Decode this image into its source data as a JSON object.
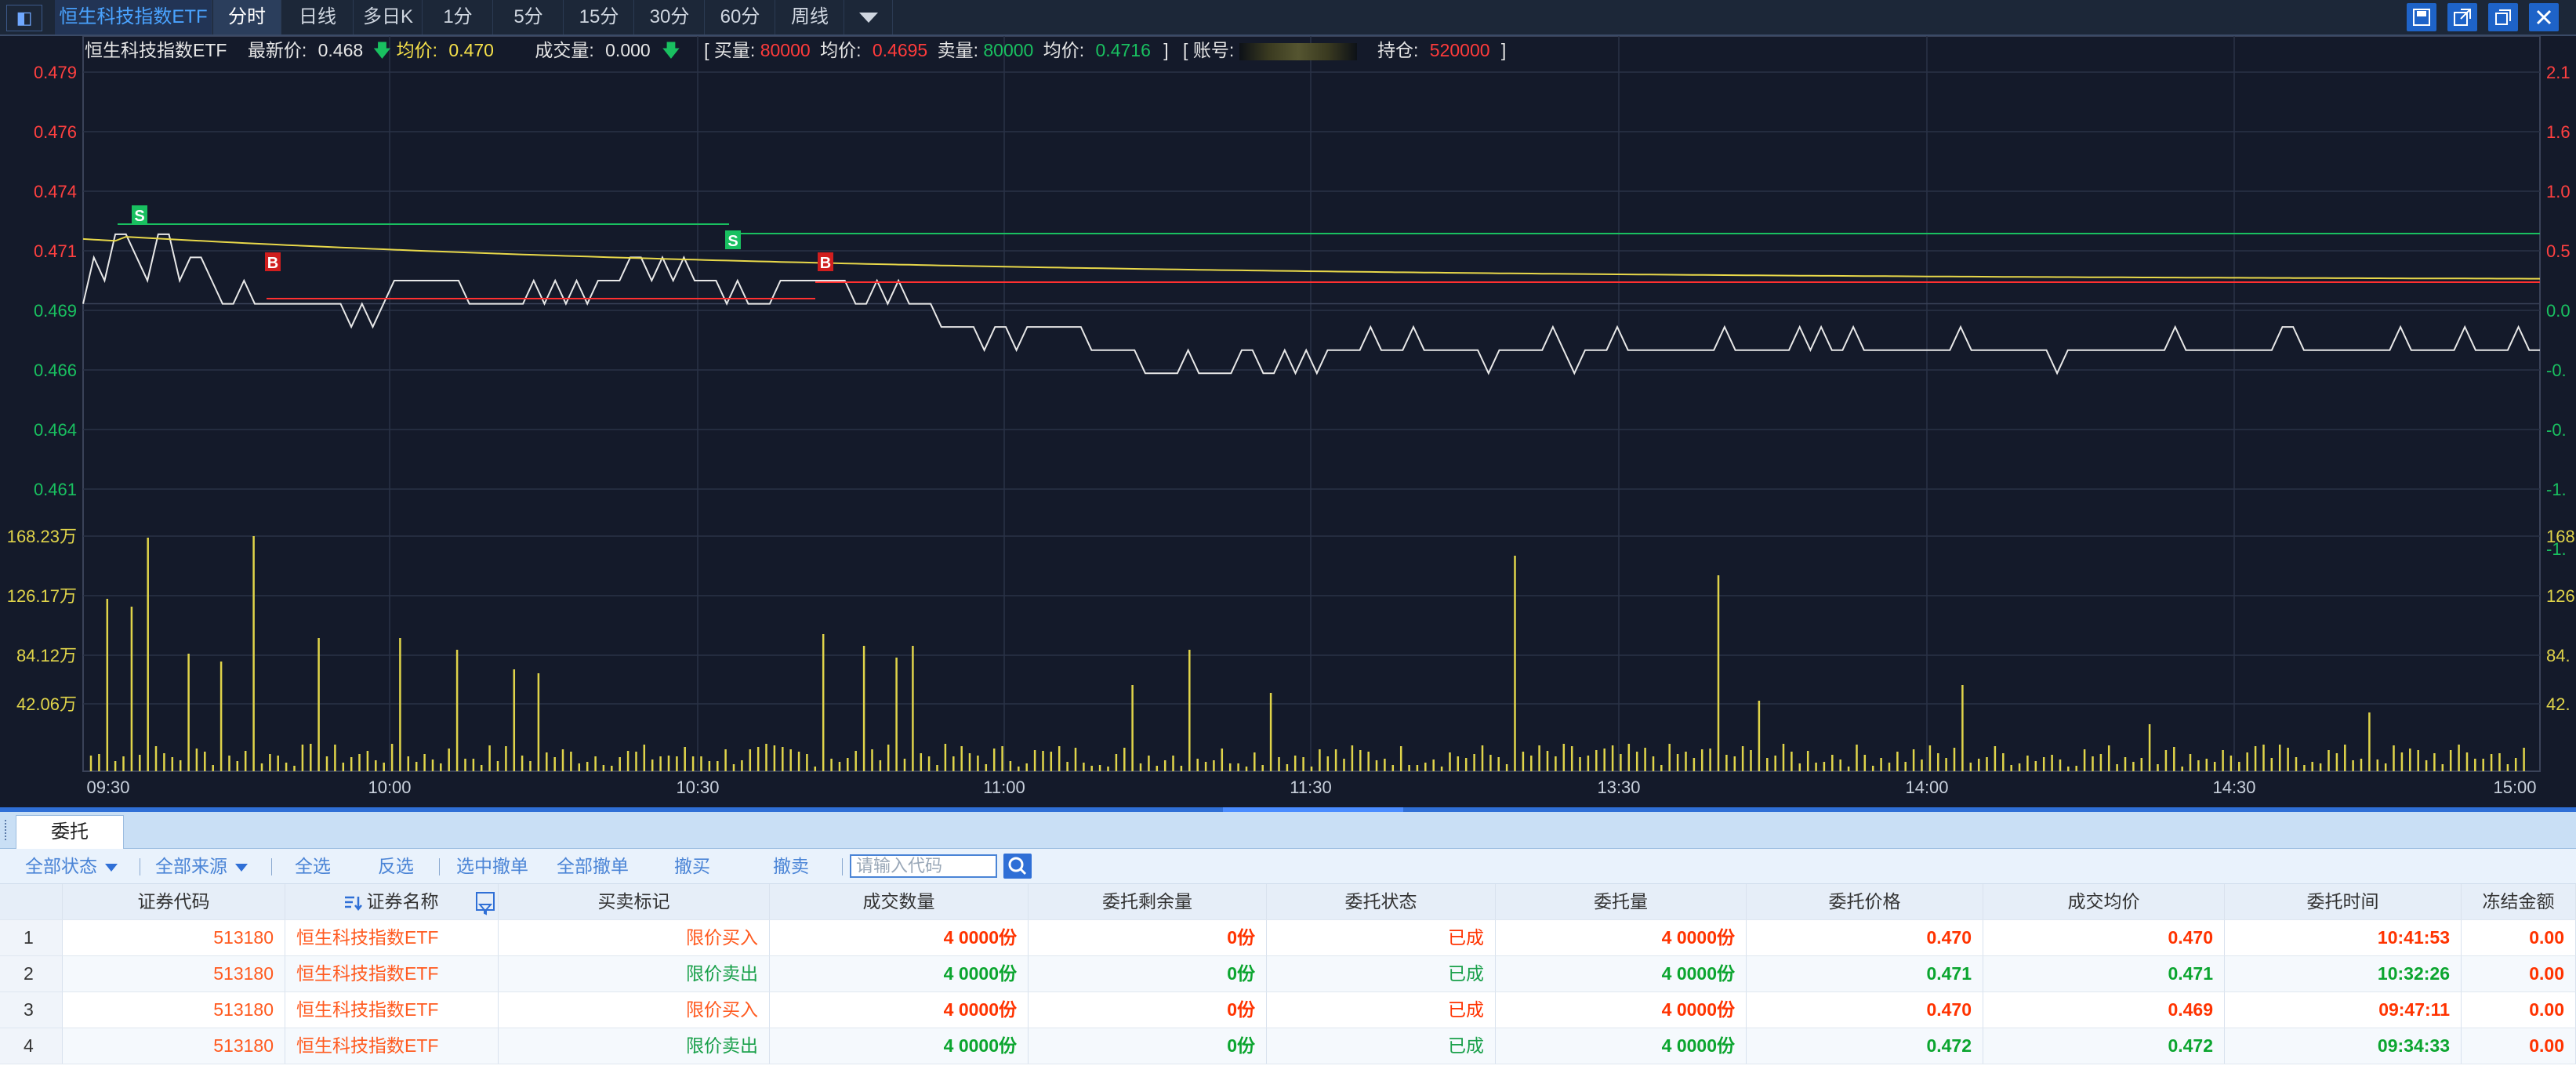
{
  "topbar": {
    "title": "恒生科技指数ETF",
    "tabs": [
      "分时",
      "日线",
      "多日K",
      "1分",
      "5分",
      "15分",
      "30分",
      "60分",
      "周线"
    ],
    "active_tab": "分时"
  },
  "info": {
    "name": "恒生科技指数ETF",
    "last_label": "最新价:",
    "last_value": "0.468",
    "avg_label": "均价:",
    "avg_value": "0.470",
    "vol_label": "成交量:",
    "vol_value": "0.000",
    "buy_label": "买量:",
    "buy_value": "80000",
    "buy_avg_label": "均价:",
    "buy_avg_value": "0.4695",
    "sell_label": "卖量:",
    "sell_value": "80000",
    "sell_avg_label": "均价:",
    "sell_avg_value": "0.4716",
    "account_label": "账号:",
    "position_label": "持仓:",
    "position_value": "520000",
    "bracket_open": "[",
    "bracket_close": "]"
  },
  "chart_data": {
    "type": "line",
    "price_ticks": [
      "0.479",
      "0.476",
      "0.474",
      "0.471",
      "0.469",
      "0.466",
      "0.464",
      "0.461"
    ],
    "price_ticks_red": [
      "0.479",
      "0.476",
      "0.474",
      "0.471"
    ],
    "pct_ticks": [
      "2.1",
      "1.6",
      "1.0",
      "0.5",
      "0.0",
      "-0.",
      "-0.",
      "-1.",
      "-1."
    ],
    "volume_ticks": [
      "168.23万",
      "126.17万",
      "84.12万",
      "42.06万"
    ],
    "volume_ticks_right": [
      "168",
      "126",
      "84.",
      "42."
    ],
    "time_ticks": [
      "09:30",
      "10:00",
      "10:30",
      "11:00",
      "11:30",
      "13:30",
      "14:00",
      "14:30",
      "15:00"
    ],
    "ylim": [
      0.461,
      0.479
    ],
    "prev_close": 0.469,
    "price_series": [
      0.469,
      0.471,
      0.47,
      0.472,
      0.472,
      0.471,
      0.47,
      0.472,
      0.472,
      0.47,
      0.471,
      0.471,
      0.47,
      0.469,
      0.469,
      0.47,
      0.469,
      0.469,
      0.469,
      0.469,
      0.469,
      0.469,
      0.469,
      0.469,
      0.469,
      0.468,
      0.469,
      0.468,
      0.469,
      0.47,
      0.47,
      0.47,
      0.47,
      0.47,
      0.47,
      0.47,
      0.469,
      0.469,
      0.469,
      0.469,
      0.469,
      0.469,
      0.47,
      0.469,
      0.47,
      0.469,
      0.47,
      0.469,
      0.47,
      0.47,
      0.47,
      0.471,
      0.471,
      0.47,
      0.471,
      0.47,
      0.471,
      0.47,
      0.47,
      0.47,
      0.469,
      0.47,
      0.469,
      0.469,
      0.469,
      0.47,
      0.47,
      0.47,
      0.47,
      0.47,
      0.47,
      0.47,
      0.469,
      0.469,
      0.47,
      0.469,
      0.47,
      0.469,
      0.469,
      0.469,
      0.468,
      0.468,
      0.468,
      0.468,
      0.467,
      0.468,
      0.468,
      0.467,
      0.468,
      0.468,
      0.468,
      0.468,
      0.468,
      0.468,
      0.467,
      0.467,
      0.467,
      0.467,
      0.467,
      0.466,
      0.466,
      0.466,
      0.466,
      0.467,
      0.466,
      0.466,
      0.466,
      0.466,
      0.467,
      0.467,
      0.466,
      0.466,
      0.467,
      0.466,
      0.467,
      0.466,
      0.467,
      0.467,
      0.467,
      0.467,
      0.468,
      0.467,
      0.467,
      0.467,
      0.468,
      0.467,
      0.467,
      0.467,
      0.467,
      0.467,
      0.467,
      0.466,
      0.467,
      0.467,
      0.467,
      0.467,
      0.467,
      0.468,
      0.467,
      0.466,
      0.467,
      0.467,
      0.467,
      0.468,
      0.467,
      0.467,
      0.467,
      0.467,
      0.467,
      0.467,
      0.467,
      0.467,
      0.467,
      0.468,
      0.467,
      0.467,
      0.467,
      0.467,
      0.467,
      0.467,
      0.468,
      0.467,
      0.468,
      0.467,
      0.467,
      0.468,
      0.467,
      0.467,
      0.467,
      0.467,
      0.467,
      0.467,
      0.467,
      0.467,
      0.467,
      0.468,
      0.467,
      0.467,
      0.467,
      0.467,
      0.467,
      0.467,
      0.467,
      0.467,
      0.466,
      0.467,
      0.467,
      0.467,
      0.467,
      0.467,
      0.467,
      0.467,
      0.467,
      0.467,
      0.467,
      0.468,
      0.467,
      0.467,
      0.467,
      0.467,
      0.467,
      0.467,
      0.467,
      0.467,
      0.467,
      0.468,
      0.468,
      0.467,
      0.467,
      0.467,
      0.467,
      0.467,
      0.467,
      0.467,
      0.467,
      0.467,
      0.468,
      0.467,
      0.467,
      0.467,
      0.467,
      0.467,
      0.468,
      0.467,
      0.467,
      0.467,
      0.467,
      0.468,
      0.467,
      0.467
    ],
    "avg_series_start": 0.472,
    "avg_series_end": 0.47,
    "buy_line": 0.469,
    "sell_line": 0.471,
    "trade_markers": [
      {
        "label": "S",
        "time": "09:34",
        "price": 0.472
      },
      {
        "label": "B",
        "time": "09:47",
        "price": 0.469
      },
      {
        "label": "S",
        "time": "10:32",
        "price": 0.471
      },
      {
        "label": "B",
        "time": "10:41",
        "price": 0.469
      }
    ]
  },
  "lower": {
    "tab_label": "委托",
    "toolbar": {
      "all_status": "全部状态",
      "all_source": "全部来源",
      "select_all": "全选",
      "invert": "反选",
      "cancel_selected": "选中撤单",
      "cancel_all": "全部撤单",
      "cancel_buy": "撤买",
      "cancel_sell": "撤卖",
      "code_placeholder": "请输入代码"
    },
    "columns": [
      "证券代码",
      "证券名称",
      "买卖标记",
      "成交数量",
      "委托剩余量",
      "委托状态",
      "委托量",
      "委托价格",
      "成交均价",
      "委托时间",
      "冻结金额"
    ],
    "rows": [
      {
        "n": "1",
        "code": "513180",
        "name": "恒生科技指数ETF",
        "mark": "限价买入",
        "qty": "4 0000份",
        "remain": "0份",
        "status": "已成",
        "order_qty": "4 0000份",
        "price": "0.470",
        "avg": "0.470",
        "time": "10:41:53",
        "frozen": "0.00",
        "side": "buy"
      },
      {
        "n": "2",
        "code": "513180",
        "name": "恒生科技指数ETF",
        "mark": "限价卖出",
        "qty": "4 0000份",
        "remain": "0份",
        "status": "已成",
        "order_qty": "4 0000份",
        "price": "0.471",
        "avg": "0.471",
        "time": "10:32:26",
        "frozen": "0.00",
        "side": "sell"
      },
      {
        "n": "3",
        "code": "513180",
        "name": "恒生科技指数ETF",
        "mark": "限价买入",
        "qty": "4 0000份",
        "remain": "0份",
        "status": "已成",
        "order_qty": "4 0000份",
        "price": "0.470",
        "avg": "0.469",
        "time": "09:47:11",
        "frozen": "0.00",
        "side": "buy"
      },
      {
        "n": "4",
        "code": "513180",
        "name": "恒生科技指数ETF",
        "mark": "限价卖出",
        "qty": "4 0000份",
        "remain": "0份",
        "status": "已成",
        "order_qty": "4 0000份",
        "price": "0.472",
        "avg": "0.472",
        "time": "09:34:33",
        "frozen": "0.00",
        "side": "sell"
      }
    ]
  }
}
